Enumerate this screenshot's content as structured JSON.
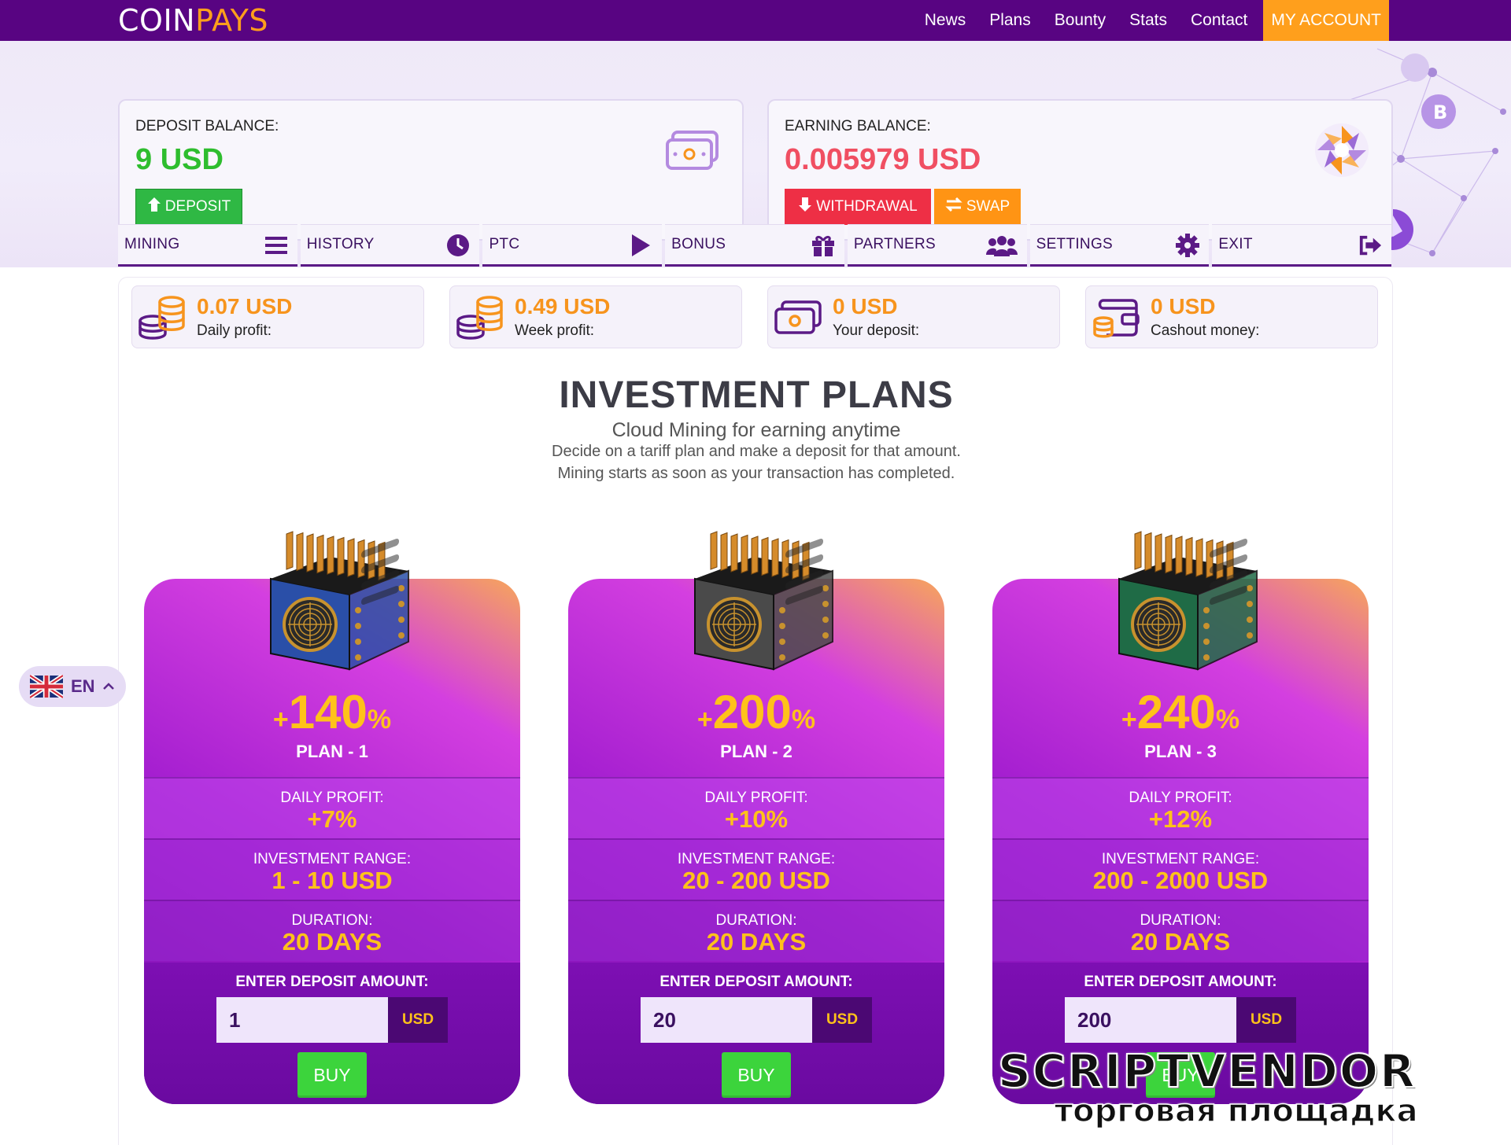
{
  "brand": {
    "part1": "COIN",
    "part2": "PAYS"
  },
  "nav": {
    "items": [
      "News",
      "Plans",
      "Bounty",
      "Stats",
      "Contact"
    ],
    "account": "MY ACCOUNT"
  },
  "balances": {
    "deposit": {
      "label": "DEPOSIT BALANCE:",
      "amount": "9 USD",
      "button": "DEPOSIT"
    },
    "earning": {
      "label": "EARNING BALANCE:",
      "amount": "0.005979 USD",
      "withdraw": "WITHDRAWAL",
      "swap": "SWAP"
    }
  },
  "tabs": [
    {
      "label": "MINING",
      "icon": "menu-icon"
    },
    {
      "label": "HISTORY",
      "icon": "clock-icon"
    },
    {
      "label": "PTC",
      "icon": "play-icon"
    },
    {
      "label": "BONUS",
      "icon": "gift-icon"
    },
    {
      "label": "PARTNERS",
      "icon": "users-icon"
    },
    {
      "label": "SETTINGS",
      "icon": "gear-icon"
    },
    {
      "label": "EXIT",
      "icon": "sign-out-icon"
    }
  ],
  "stats": [
    {
      "value": "0.07 USD",
      "label": "Daily profit:",
      "icon": "coins-icon"
    },
    {
      "value": "0.49 USD",
      "label": "Week profit:",
      "icon": "coins-icon"
    },
    {
      "value": "0 USD",
      "label": "Your deposit:",
      "icon": "money-icon"
    },
    {
      "value": "0 USD",
      "label": "Cashout money:",
      "icon": "wallet-icon"
    }
  ],
  "investment": {
    "title": "INVESTMENT PLANS",
    "subtitle": "Cloud Mining for earning anytime",
    "desc1": "Decide on a tariff plan and make a deposit for that amount.",
    "desc2": "Mining starts as soon as your transaction has completed."
  },
  "plans": [
    {
      "plus": "+",
      "pct": "140",
      "pct_sign": "%",
      "name": "PLAN - 1",
      "daily_label": "DAILY PROFIT:",
      "daily": "+7%",
      "range_label": "INVESTMENT RANGE:",
      "range": "1 - 10 USD",
      "duration_label": "DURATION:",
      "duration": "20 DAYS",
      "enter_label": "ENTER DEPOSIT AMOUNT:",
      "amount": "1",
      "currency": "USD",
      "buy": "BUY",
      "color": "#2a4fa8"
    },
    {
      "plus": "+",
      "pct": "200",
      "pct_sign": "%",
      "name": "PLAN - 2",
      "daily_label": "DAILY PROFIT:",
      "daily": "+10%",
      "range_label": "INVESTMENT RANGE:",
      "range": "20 - 200 USD",
      "duration_label": "DURATION:",
      "duration": "20 DAYS",
      "enter_label": "ENTER DEPOSIT AMOUNT:",
      "amount": "20",
      "currency": "USD",
      "buy": "BUY",
      "color": "#4a4a4a"
    },
    {
      "plus": "+",
      "pct": "240",
      "pct_sign": "%",
      "name": "PLAN - 3",
      "daily_label": "DAILY PROFIT:",
      "daily": "+12%",
      "range_label": "INVESTMENT RANGE:",
      "range": "200 - 2000 USD",
      "duration_label": "DURATION:",
      "duration": "20 DAYS",
      "enter_label": "ENTER DEPOSIT AMOUNT:",
      "amount": "200",
      "currency": "USD",
      "buy": "BUY",
      "color": "#1f6b46"
    }
  ],
  "lang": {
    "code": "EN"
  },
  "watermark": {
    "line1": "SCRIPTVENDOR",
    "line2": "торговая площадка"
  },
  "colors": {
    "primary": "#580482",
    "accent": "#ff9f1c",
    "green": "#2ebd2e",
    "pink": "#f04f62",
    "gold": "#ffc21a"
  }
}
